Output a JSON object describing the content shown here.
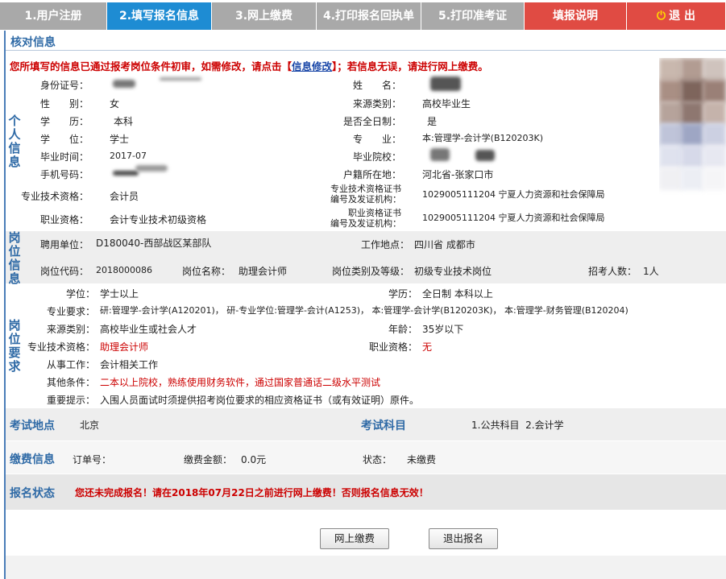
{
  "nav": {
    "tabs": [
      "1.用户注册",
      "2.填写报名信息",
      "3.网上缴费",
      "4.打印报名回执单",
      "5.打印准考证",
      "填报说明",
      "退 出"
    ]
  },
  "header": {
    "title": "核对信息"
  },
  "notice": {
    "before": "您所填写的信息已通过报考岗位条件初审，如需修改，请点击【",
    "link": "信息修改",
    "after": "】；若信息无误，请进行网上缴费。"
  },
  "personal": {
    "section_title": "个人信息",
    "id_label": "身份证号：",
    "name_label": "姓　　名：",
    "gender_label": "性　　别：",
    "gender": "女",
    "source_label": "来源类别：",
    "source": "高校毕业生",
    "edu_label": "学　　历：",
    "edu": "本科",
    "fulltime_label": "是否全日制：",
    "fulltime": "是",
    "degree_label": "学　　位：",
    "degree": "学士",
    "major_label": "专　　业：",
    "major": "本:管理学-会计学(B120203K)",
    "gradtime_label": "毕业时间：",
    "gradtime": "2017-07",
    "school_label": "毕业院校：",
    "phone_label": "手机号码：",
    "hukou_label": "户籍所在地：",
    "hukou": "河北省-张家口市",
    "tech_label": "专业技术资格：",
    "tech": "会计员",
    "techcert_label1": "专业技术资格证书",
    "techcert_label2": "编号及发证机构：",
    "techcert": "1029005111204 宁夏人力资源和社会保障局",
    "job_label": "职业资格：",
    "job": "会计专业技术初级资格",
    "jobcert_label1": "职业资格证书",
    "jobcert_label2": "编号及发证机构：",
    "jobcert": "1029005111204 宁夏人力资源和社会保障局"
  },
  "post": {
    "section_title": "岗位信息",
    "unit_label": "聘用单位：",
    "unit": "D180040-西部战区某部队",
    "loc_label": "工作地点：",
    "loc": "四川省 成都市",
    "code_label": "岗位代码：",
    "code": "2018000086",
    "name_label": "岗位名称：",
    "name": "助理会计师",
    "type_label": "岗位类别及等级：",
    "type": "初级专业技术岗位",
    "count_label": "招考人数：",
    "count": "1人"
  },
  "req": {
    "section_title": "岗位要求",
    "degree_label": "学位：",
    "degree": "学士以上",
    "edu_label": "学历：",
    "edu": "全日制 本科以上",
    "major_label": "专业要求：",
    "major": "研:管理学-会计学(A120201)， 研-专业学位:管理学-会计(A1253)， 本:管理学-会计学(B120203K)， 本:管理学-财务管理(B120204)",
    "source_label": "来源类别：",
    "source": "高校毕业生或社会人才",
    "age_label": "年龄：",
    "age": "35岁以下",
    "tech_label": "专业技术资格：",
    "tech": "助理会计师",
    "job_label": "职业资格：",
    "job": "无",
    "work_label": "从事工作：",
    "work": "会计相关工作",
    "other_label": "其他条件：",
    "other": "二本以上院校，熟练使用财务软件，通过国家普通话二级水平测试",
    "tip_label": "重要提示：",
    "tip": "入围人员面试时须提供招考岗位要求的相应资格证书（或有效证明）原件。"
  },
  "exam": {
    "place_title": "考试地点",
    "place": "北京",
    "subject_title": "考试科目",
    "subjects": "1.公共科目  2.会计学"
  },
  "fee": {
    "title": "缴费信息",
    "order_label": "订单号：",
    "amount_label": "缴费金额：",
    "amount": "0.0元",
    "status_label": "状态：",
    "status": "未缴费"
  },
  "signup": {
    "title": "报名状态",
    "msg": "您还未完成报名！请在2018年07月22日之前进行网上缴费！否则报名信息无效！"
  },
  "buttons": {
    "pay": "网上缴费",
    "quit": "退出报名"
  },
  "colors": {
    "accent": "#1e8cd3",
    "tab_gray": "#a9a9a9",
    "tab_red": "#e04b43",
    "section_blue": "#2f6aa6",
    "warning_red": "#cc0000"
  }
}
